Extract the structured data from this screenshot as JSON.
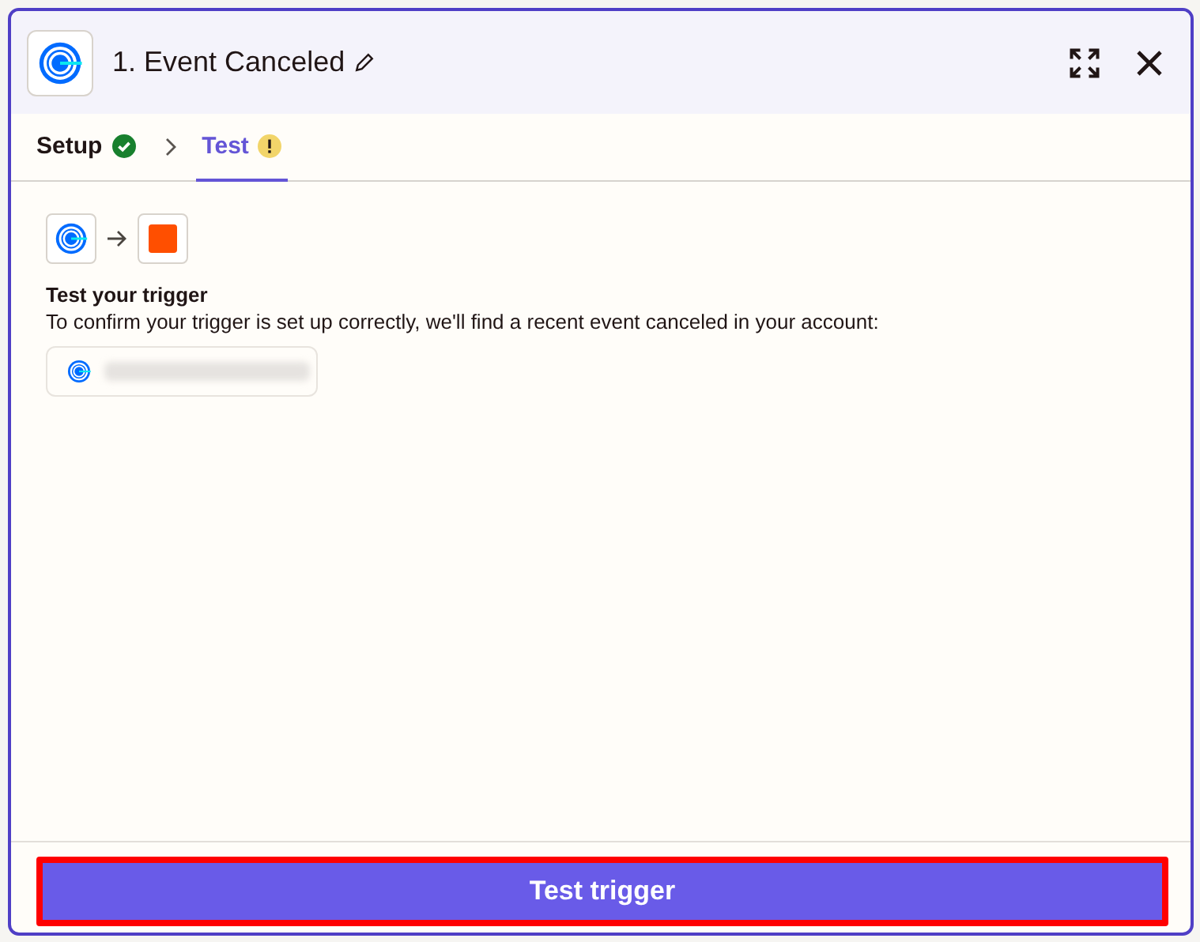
{
  "header": {
    "title": "1. Event Canceled"
  },
  "steps": [
    {
      "label": "Setup",
      "kind": "done",
      "selected": false
    },
    {
      "label": "Test",
      "kind": "warning",
      "selected": true
    }
  ],
  "content": {
    "heading": "Test your trigger",
    "description": "To confirm your trigger is set up correctly, we'll find a recent event canceled in your account:",
    "account": {
      "redacted": true
    }
  },
  "footer": {
    "button": {
      "label": "Test trigger",
      "highlighted": true
    }
  }
}
